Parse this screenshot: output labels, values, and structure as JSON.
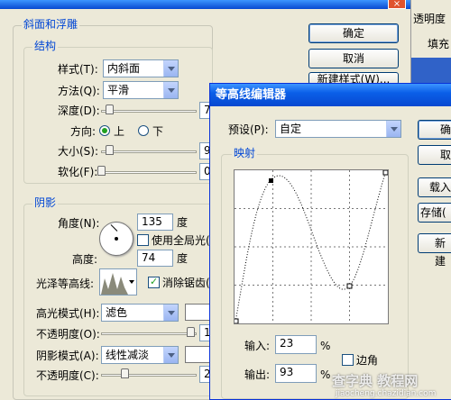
{
  "bg": {
    "title_close": "×",
    "right_panel": {
      "tab": "透明度",
      "fill_label": "填充"
    }
  },
  "main": {
    "section_title": "斜面和浮雕",
    "structure_legend": "结构",
    "style_label": "样式(T):",
    "style_value": "内斜面",
    "method_label": "方法(Q):",
    "method_value": "平滑",
    "depth_label": "深度(D):",
    "depth_value": "75",
    "direction_label": "方向:",
    "direction_up": "上",
    "direction_down": "下",
    "size_label": "大小(S):",
    "size_value": "9",
    "soften_label": "软化(F):",
    "soften_value": "0",
    "shading_legend": "阴影",
    "angle_label": "角度(N):",
    "angle_value": "135",
    "degree_unit": "度",
    "global_light": "使用全局光(G)",
    "altitude_label": "高度:",
    "altitude_value": "74",
    "altitude_unit": "度",
    "gloss_label": "光泽等高线:",
    "antialias": "消除锯齿(L)",
    "highlight_mode_label": "高光模式(H):",
    "highlight_mode_value": "滤色",
    "opacity1_label": "不透明度(O):",
    "opacity1_value": "100",
    "shadow_mode_label": "阴影模式(A):",
    "shadow_mode_value": "线性减淡",
    "opacity2_label": "不透明度(C):",
    "opacity2_value": "26"
  },
  "buttons": {
    "ok": "确定",
    "cancel": "取消",
    "new_style": "新建样式(W)..."
  },
  "contour_dialog": {
    "title": "等高线编辑器",
    "preset_label": "预设(P):",
    "preset_value": "自定",
    "mapping_legend": "映射",
    "input_label": "输入:",
    "input_value": "23",
    "output_label": "输出:",
    "output_value": "93",
    "percent": "%",
    "corner_label": "边角",
    "btn_ok": "确",
    "btn_cancel": "取",
    "btn_load": "载入",
    "btn_save": "存储(",
    "btn_new": "新建"
  },
  "watermark": {
    "text": "查字典 教程网",
    "url": "jiaocheng.chazidian.com"
  },
  "colors": {
    "accent": "#0046d5",
    "titlebar": "#0a5fe8"
  }
}
